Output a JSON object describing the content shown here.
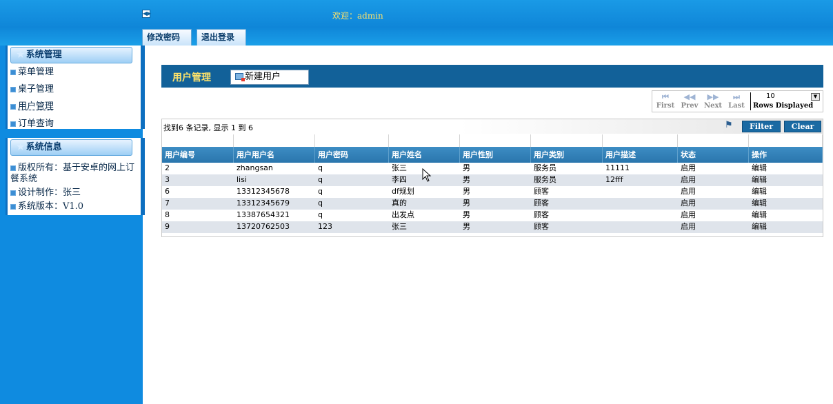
{
  "header": {
    "welcome": "欢迎：admin",
    "buttons": [
      "修改密码",
      "退出登录"
    ]
  },
  "sidebar": {
    "panel1": {
      "title": "系统管理",
      "items": [
        "菜单管理",
        "桌子管理",
        "用户管理",
        "订单查询"
      ]
    },
    "panel2": {
      "title": "系统信息",
      "items": [
        "版权所有：基于安卓的网上订餐系统",
        "设计制作：张三",
        "系统版本：V1.0"
      ]
    }
  },
  "main": {
    "title": "用户管理",
    "new_button": "新建用户",
    "pager": {
      "first": "First",
      "prev": "Prev",
      "next": "Next",
      "last": "Last",
      "rows_value": "10",
      "rows_label": "Rows Displayed"
    },
    "grid": {
      "status_text": "找到6 条记录, 显示 1 到 6",
      "filter": "Filter",
      "clear": "Clear",
      "columns": [
        "用户编号",
        "用户用户名",
        "用户密码",
        "用户姓名",
        "用户性别",
        "用户类别",
        "用户描述",
        "状态",
        "操作"
      ],
      "rows": [
        [
          "2",
          "zhangsan",
          "q",
          "张三",
          "男",
          "服务员",
          "11111",
          "启用",
          "编辑"
        ],
        [
          "3",
          "lisi",
          "q",
          "李四",
          "男",
          "服务员",
          "12fff",
          "启用",
          "编辑"
        ],
        [
          "6",
          "13312345678",
          "q",
          "df规划",
          "男",
          "顾客",
          "",
          "启用",
          "编辑"
        ],
        [
          "7",
          "13312345679",
          "q",
          "真的",
          "男",
          "顾客",
          "",
          "启用",
          "编辑"
        ],
        [
          "8",
          "13387654321",
          "q",
          "出发点",
          "男",
          "顾客",
          "",
          "启用",
          "编辑"
        ],
        [
          "9",
          "13720762503",
          "123",
          "张三",
          "男",
          "顾客",
          "",
          "启用",
          "编辑"
        ]
      ]
    }
  }
}
